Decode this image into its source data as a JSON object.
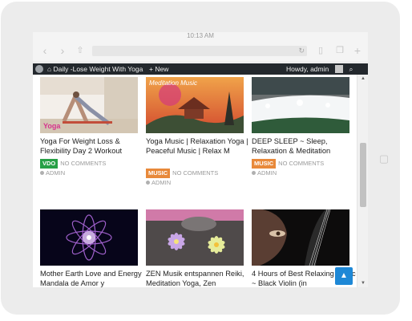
{
  "status_bar": {
    "time": "10:13 AM"
  },
  "browser": {
    "back_icon": "chevron-left-icon",
    "forward_icon": "chevron-right-icon",
    "share_icon": "share-icon",
    "reload_icon": "reload-icon",
    "bookmarks_icon": "book-icon",
    "tabs_icon": "tabs-icon",
    "new_tab_icon": "plus-icon"
  },
  "admin_bar": {
    "site_name": "Daily -Lose Weight With Yoga",
    "new_label": "+ New",
    "greeting": "Howdy, admin"
  },
  "posts": [
    {
      "title": "Yoga For Weight Loss & Flexibility Day 2 Workout",
      "badge": "VDO",
      "badge_color": "#27a046",
      "comments": "NO COMMENTS",
      "author": "ADMIN",
      "thumb_overlay": "Yoga"
    },
    {
      "title": "Yoga Music | Relaxation Yoga | Peaceful Music | Relax M",
      "badge": "MUSIC",
      "badge_color": "#e8893a",
      "comments": "NO COMMENTS",
      "author": "ADMIN",
      "thumb_overlay": "Meditation Music"
    },
    {
      "title": "DEEP SLEEP ~ Sleep, Relaxation & Meditation",
      "badge": "MUSIC",
      "badge_color": "#e8893a",
      "comments": "NO COMMENTS",
      "author": "ADMIN",
      "thumb_overlay": ""
    },
    {
      "title": "Mother Earth Love and Energy Mandala de Amor y",
      "badge": "",
      "badge_color": "",
      "comments": "",
      "author": "",
      "thumb_overlay": ""
    },
    {
      "title": "ZEN Musik entspannen Reiki, Meditation Yoga, Zen",
      "badge": "",
      "badge_color": "",
      "comments": "",
      "author": "",
      "thumb_overlay": ""
    },
    {
      "title": "4 Hours of Best Relaxing Music ~ Black Violin (in",
      "badge": "",
      "badge_color": "",
      "comments": "",
      "author": "",
      "thumb_overlay": ""
    }
  ],
  "back_to_top_icon": "chevron-up-icon"
}
